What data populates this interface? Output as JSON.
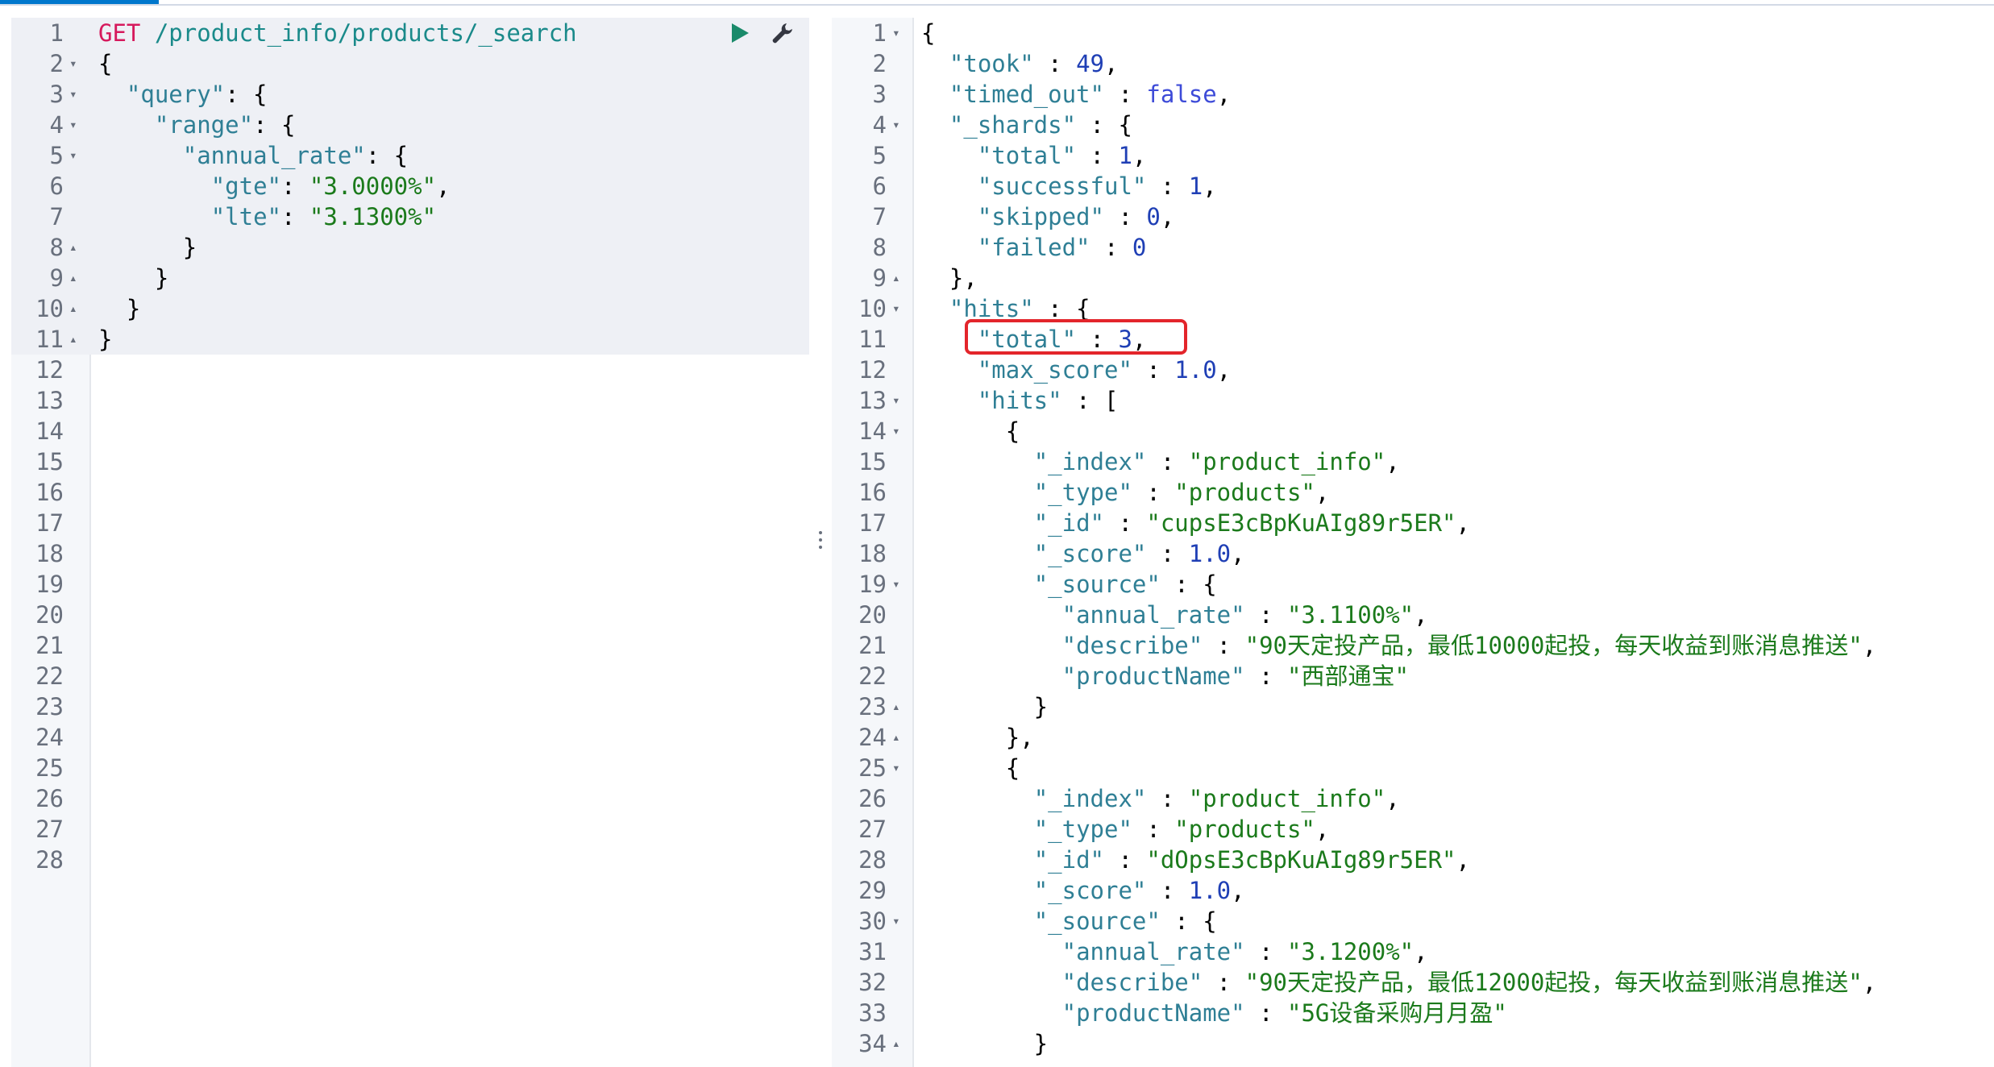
{
  "request": {
    "fold_up": "▴",
    "fold_down": "▾",
    "lines": [
      {
        "n": "1",
        "tokens": [
          {
            "t": "GET",
            "c": "m"
          },
          {
            "t": " /product_info/products/_search",
            "c": "u"
          }
        ]
      },
      {
        "n": "2",
        "fold": "down",
        "tokens": [
          {
            "t": "{",
            "c": "p"
          }
        ]
      },
      {
        "n": "3",
        "fold": "down",
        "tokens": [
          {
            "t": "  ",
            "c": "p"
          },
          {
            "t": "\"query\"",
            "c": "k"
          },
          {
            "t": ": {",
            "c": "p"
          }
        ]
      },
      {
        "n": "4",
        "fold": "down",
        "tokens": [
          {
            "t": "    ",
            "c": "p"
          },
          {
            "t": "\"range\"",
            "c": "k"
          },
          {
            "t": ": {",
            "c": "p"
          }
        ]
      },
      {
        "n": "5",
        "fold": "down",
        "tokens": [
          {
            "t": "      ",
            "c": "p"
          },
          {
            "t": "\"annual_rate\"",
            "c": "k"
          },
          {
            "t": ": {",
            "c": "p"
          }
        ]
      },
      {
        "n": "6",
        "tokens": [
          {
            "t": "        ",
            "c": "p"
          },
          {
            "t": "\"gte\"",
            "c": "k"
          },
          {
            "t": ": ",
            "c": "p"
          },
          {
            "t": "\"3.0000%\"",
            "c": "s"
          },
          {
            "t": ",",
            "c": "p"
          }
        ]
      },
      {
        "n": "7",
        "tokens": [
          {
            "t": "        ",
            "c": "p"
          },
          {
            "t": "\"lte\"",
            "c": "k"
          },
          {
            "t": ": ",
            "c": "p"
          },
          {
            "t": "\"3.1300%\"",
            "c": "s"
          }
        ]
      },
      {
        "n": "8",
        "fold": "up",
        "tokens": [
          {
            "t": "      }",
            "c": "p"
          }
        ]
      },
      {
        "n": "9",
        "fold": "up",
        "tokens": [
          {
            "t": "    }",
            "c": "p"
          }
        ]
      },
      {
        "n": "10",
        "fold": "up",
        "tokens": [
          {
            "t": "  }",
            "c": "p"
          }
        ]
      },
      {
        "n": "11",
        "fold": "up",
        "tokens": [
          {
            "t": "}",
            "c": "p"
          }
        ]
      },
      {
        "n": "12",
        "tokens": []
      },
      {
        "n": "13",
        "tokens": []
      },
      {
        "n": "14",
        "tokens": []
      },
      {
        "n": "15",
        "tokens": []
      },
      {
        "n": "16",
        "tokens": []
      },
      {
        "n": "17",
        "tokens": []
      },
      {
        "n": "18",
        "tokens": []
      },
      {
        "n": "19",
        "tokens": []
      },
      {
        "n": "20",
        "tokens": []
      },
      {
        "n": "21",
        "tokens": []
      },
      {
        "n": "22",
        "tokens": []
      },
      {
        "n": "23",
        "tokens": []
      },
      {
        "n": "24",
        "tokens": []
      },
      {
        "n": "25",
        "tokens": []
      },
      {
        "n": "26",
        "tokens": []
      },
      {
        "n": "27",
        "tokens": []
      },
      {
        "n": "28",
        "tokens": []
      }
    ],
    "highlight_lines": 11
  },
  "response": {
    "lines": [
      {
        "n": "1",
        "fold": "down",
        "tokens": [
          {
            "t": "{",
            "c": "p"
          }
        ]
      },
      {
        "n": "2",
        "tokens": [
          {
            "t": "  ",
            "c": "p"
          },
          {
            "t": "\"took\"",
            "c": "k"
          },
          {
            "t": " : ",
            "c": "p"
          },
          {
            "t": "49",
            "c": "n"
          },
          {
            "t": ",",
            "c": "p"
          }
        ]
      },
      {
        "n": "3",
        "tokens": [
          {
            "t": "  ",
            "c": "p"
          },
          {
            "t": "\"timed_out\"",
            "c": "k"
          },
          {
            "t": " : ",
            "c": "p"
          },
          {
            "t": "false",
            "c": "b"
          },
          {
            "t": ",",
            "c": "p"
          }
        ]
      },
      {
        "n": "4",
        "fold": "down",
        "tokens": [
          {
            "t": "  ",
            "c": "p"
          },
          {
            "t": "\"_shards\"",
            "c": "k"
          },
          {
            "t": " : {",
            "c": "p"
          }
        ]
      },
      {
        "n": "5",
        "tokens": [
          {
            "t": "    ",
            "c": "p"
          },
          {
            "t": "\"total\"",
            "c": "k"
          },
          {
            "t": " : ",
            "c": "p"
          },
          {
            "t": "1",
            "c": "n"
          },
          {
            "t": ",",
            "c": "p"
          }
        ]
      },
      {
        "n": "6",
        "tokens": [
          {
            "t": "    ",
            "c": "p"
          },
          {
            "t": "\"successful\"",
            "c": "k"
          },
          {
            "t": " : ",
            "c": "p"
          },
          {
            "t": "1",
            "c": "n"
          },
          {
            "t": ",",
            "c": "p"
          }
        ]
      },
      {
        "n": "7",
        "tokens": [
          {
            "t": "    ",
            "c": "p"
          },
          {
            "t": "\"skipped\"",
            "c": "k"
          },
          {
            "t": " : ",
            "c": "p"
          },
          {
            "t": "0",
            "c": "n"
          },
          {
            "t": ",",
            "c": "p"
          }
        ]
      },
      {
        "n": "8",
        "tokens": [
          {
            "t": "    ",
            "c": "p"
          },
          {
            "t": "\"failed\"",
            "c": "k"
          },
          {
            "t": " : ",
            "c": "p"
          },
          {
            "t": "0",
            "c": "n"
          }
        ]
      },
      {
        "n": "9",
        "fold": "up",
        "tokens": [
          {
            "t": "  },",
            "c": "p"
          }
        ]
      },
      {
        "n": "10",
        "fold": "down",
        "tokens": [
          {
            "t": "  ",
            "c": "p"
          },
          {
            "t": "\"hits\"",
            "c": "k"
          },
          {
            "t": " : {",
            "c": "p"
          }
        ]
      },
      {
        "n": "11",
        "tokens": [
          {
            "t": "    ",
            "c": "p"
          },
          {
            "t": "\"total\"",
            "c": "k"
          },
          {
            "t": " : ",
            "c": "p"
          },
          {
            "t": "3",
            "c": "n"
          },
          {
            "t": ",",
            "c": "p"
          }
        ]
      },
      {
        "n": "12",
        "tokens": [
          {
            "t": "    ",
            "c": "p"
          },
          {
            "t": "\"max_score\"",
            "c": "k"
          },
          {
            "t": " : ",
            "c": "p"
          },
          {
            "t": "1.0",
            "c": "n"
          },
          {
            "t": ",",
            "c": "p"
          }
        ]
      },
      {
        "n": "13",
        "fold": "down",
        "tokens": [
          {
            "t": "    ",
            "c": "p"
          },
          {
            "t": "\"hits\"",
            "c": "k"
          },
          {
            "t": " : [",
            "c": "p"
          }
        ]
      },
      {
        "n": "14",
        "fold": "down",
        "tokens": [
          {
            "t": "      {",
            "c": "p"
          }
        ]
      },
      {
        "n": "15",
        "tokens": [
          {
            "t": "        ",
            "c": "p"
          },
          {
            "t": "\"_index\"",
            "c": "k"
          },
          {
            "t": " : ",
            "c": "p"
          },
          {
            "t": "\"product_info\"",
            "c": "s"
          },
          {
            "t": ",",
            "c": "p"
          }
        ]
      },
      {
        "n": "16",
        "tokens": [
          {
            "t": "        ",
            "c": "p"
          },
          {
            "t": "\"_type\"",
            "c": "k"
          },
          {
            "t": " : ",
            "c": "p"
          },
          {
            "t": "\"products\"",
            "c": "s"
          },
          {
            "t": ",",
            "c": "p"
          }
        ]
      },
      {
        "n": "17",
        "tokens": [
          {
            "t": "        ",
            "c": "p"
          },
          {
            "t": "\"_id\"",
            "c": "k"
          },
          {
            "t": " : ",
            "c": "p"
          },
          {
            "t": "\"cupsE3cBpKuAIg89r5ER\"",
            "c": "s"
          },
          {
            "t": ",",
            "c": "p"
          }
        ]
      },
      {
        "n": "18",
        "tokens": [
          {
            "t": "        ",
            "c": "p"
          },
          {
            "t": "\"_score\"",
            "c": "k"
          },
          {
            "t": " : ",
            "c": "p"
          },
          {
            "t": "1.0",
            "c": "n"
          },
          {
            "t": ",",
            "c": "p"
          }
        ]
      },
      {
        "n": "19",
        "fold": "down",
        "tokens": [
          {
            "t": "        ",
            "c": "p"
          },
          {
            "t": "\"_source\"",
            "c": "k"
          },
          {
            "t": " : {",
            "c": "p"
          }
        ]
      },
      {
        "n": "20",
        "tokens": [
          {
            "t": "          ",
            "c": "p"
          },
          {
            "t": "\"annual_rate\"",
            "c": "k"
          },
          {
            "t": " : ",
            "c": "p"
          },
          {
            "t": "\"3.1100%\"",
            "c": "s"
          },
          {
            "t": ",",
            "c": "p"
          }
        ]
      },
      {
        "n": "21",
        "tokens": [
          {
            "t": "          ",
            "c": "p"
          },
          {
            "t": "\"describe\"",
            "c": "k"
          },
          {
            "t": " : ",
            "c": "p"
          },
          {
            "t": "\"90天定投产品，最低10000起投，每天收益到账消息推送\"",
            "c": "s"
          },
          {
            "t": ",",
            "c": "p"
          }
        ]
      },
      {
        "n": "22",
        "tokens": [
          {
            "t": "          ",
            "c": "p"
          },
          {
            "t": "\"productName\"",
            "c": "k"
          },
          {
            "t": " : ",
            "c": "p"
          },
          {
            "t": "\"西部通宝\"",
            "c": "s"
          }
        ]
      },
      {
        "n": "23",
        "fold": "up",
        "tokens": [
          {
            "t": "        }",
            "c": "p"
          }
        ]
      },
      {
        "n": "24",
        "fold": "up",
        "tokens": [
          {
            "t": "      },",
            "c": "p"
          }
        ]
      },
      {
        "n": "25",
        "fold": "down",
        "tokens": [
          {
            "t": "      {",
            "c": "p"
          }
        ]
      },
      {
        "n": "26",
        "tokens": [
          {
            "t": "        ",
            "c": "p"
          },
          {
            "t": "\"_index\"",
            "c": "k"
          },
          {
            "t": " : ",
            "c": "p"
          },
          {
            "t": "\"product_info\"",
            "c": "s"
          },
          {
            "t": ",",
            "c": "p"
          }
        ]
      },
      {
        "n": "27",
        "tokens": [
          {
            "t": "        ",
            "c": "p"
          },
          {
            "t": "\"_type\"",
            "c": "k"
          },
          {
            "t": " : ",
            "c": "p"
          },
          {
            "t": "\"products\"",
            "c": "s"
          },
          {
            "t": ",",
            "c": "p"
          }
        ]
      },
      {
        "n": "28",
        "tokens": [
          {
            "t": "        ",
            "c": "p"
          },
          {
            "t": "\"_id\"",
            "c": "k"
          },
          {
            "t": " : ",
            "c": "p"
          },
          {
            "t": "\"dOpsE3cBpKuAIg89r5ER\"",
            "c": "s"
          },
          {
            "t": ",",
            "c": "p"
          }
        ]
      },
      {
        "n": "29",
        "tokens": [
          {
            "t": "        ",
            "c": "p"
          },
          {
            "t": "\"_score\"",
            "c": "k"
          },
          {
            "t": " : ",
            "c": "p"
          },
          {
            "t": "1.0",
            "c": "n"
          },
          {
            "t": ",",
            "c": "p"
          }
        ]
      },
      {
        "n": "30",
        "fold": "down",
        "tokens": [
          {
            "t": "        ",
            "c": "p"
          },
          {
            "t": "\"_source\"",
            "c": "k"
          },
          {
            "t": " : {",
            "c": "p"
          }
        ]
      },
      {
        "n": "31",
        "tokens": [
          {
            "t": "          ",
            "c": "p"
          },
          {
            "t": "\"annual_rate\"",
            "c": "k"
          },
          {
            "t": " : ",
            "c": "p"
          },
          {
            "t": "\"3.1200%\"",
            "c": "s"
          },
          {
            "t": ",",
            "c": "p"
          }
        ]
      },
      {
        "n": "32",
        "tokens": [
          {
            "t": "          ",
            "c": "p"
          },
          {
            "t": "\"describe\"",
            "c": "k"
          },
          {
            "t": " : ",
            "c": "p"
          },
          {
            "t": "\"90天定投产品，最低12000起投，每天收益到账消息推送\"",
            "c": "s"
          },
          {
            "t": ",",
            "c": "p"
          }
        ]
      },
      {
        "n": "33",
        "tokens": [
          {
            "t": "          ",
            "c": "p"
          },
          {
            "t": "\"productName\"",
            "c": "k"
          },
          {
            "t": " : ",
            "c": "p"
          },
          {
            "t": "\"5G设备采购月月盈\"",
            "c": "s"
          }
        ]
      },
      {
        "n": "34",
        "fold": "up",
        "tokens": [
          {
            "t": "        }",
            "c": "p"
          }
        ]
      }
    ],
    "highlighted_field": "total"
  },
  "icons": {
    "run": "play-icon",
    "settings": "wrench-icon",
    "splitter": "vertical-ellipsis-icon"
  },
  "colors": {
    "accent": "#0077cc",
    "highlight_box": "#e3252b",
    "method": "#d6195c",
    "url": "#1a8a8a",
    "key": "#2f7f95",
    "string": "#1b7a1b",
    "number": "#1f3fb5",
    "run_button": "#1a8a6a"
  }
}
